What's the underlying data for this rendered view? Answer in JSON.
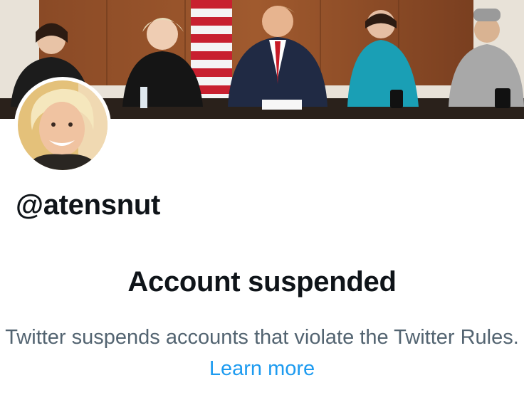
{
  "profile": {
    "handle": "@atensnut",
    "banner_icon": "profile-banner-photo",
    "avatar_icon": "profile-avatar-photo"
  },
  "suspension": {
    "title": "Account suspended",
    "message": "Twitter suspends accounts that violate the Twitter Rules.",
    "learn_more": "Learn more"
  },
  "colors": {
    "text_primary": "#0f1419",
    "text_secondary": "#536471",
    "link": "#1d9bf0"
  }
}
